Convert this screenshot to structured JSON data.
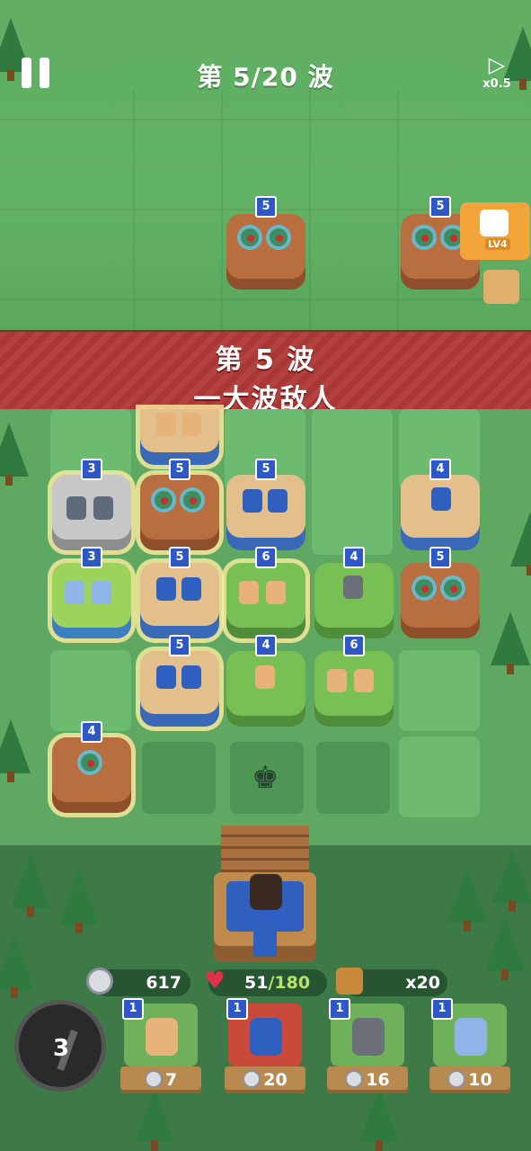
{
  "hud": {
    "wave_label": "第 5/20 波",
    "speed_label": "x0.5",
    "pause_icon": "pause-icon",
    "speed_icon": "play-icon",
    "hero_level": "LV4"
  },
  "banner": {
    "line1": "第 5 波",
    "line2": "一大波敌人"
  },
  "enemy_spawns": [
    {
      "level": "5"
    },
    {
      "level": "5"
    }
  ],
  "board_levels": {
    "r0c1": "5",
    "r0c0": "3",
    "r0c2": "5",
    "r0c4": "4",
    "r1c0": "3",
    "r1c1": "5",
    "r1c2": "6",
    "r1c3": "4",
    "r1c4": "5",
    "r2c1": "5",
    "r2c2": "4",
    "r2c3": "6",
    "r3c0": "4"
  },
  "resources": {
    "coins": "617",
    "hp_current": "51",
    "hp_max": "/180",
    "basket_count": "x20"
  },
  "shovel": {
    "count": "3"
  },
  "cards": [
    {
      "level": "1",
      "cost": "7"
    },
    {
      "level": "1",
      "cost": "20"
    },
    {
      "level": "1",
      "cost": "16"
    },
    {
      "level": "1",
      "cost": "10"
    }
  ],
  "colors": {
    "field": "#62b266",
    "banner": "#b4403f",
    "level_badge": "#2e58c8",
    "hp_max": "#b9e36a"
  }
}
